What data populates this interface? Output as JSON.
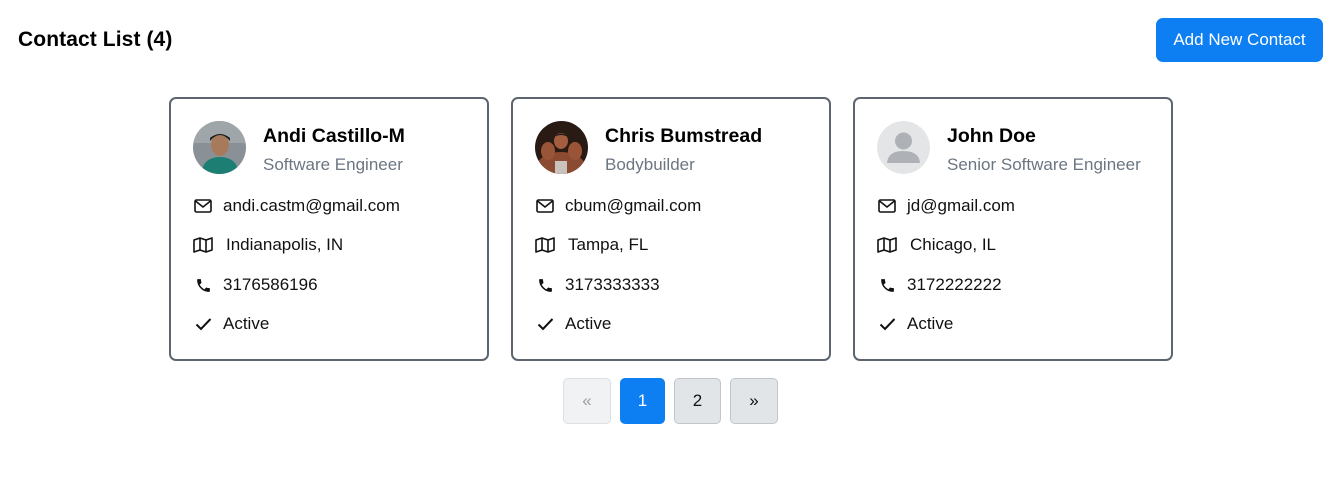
{
  "header": {
    "title": "Contact List (4)",
    "add_button_label": "Add New Contact"
  },
  "accent_color": "#0d7ff2",
  "contacts": [
    {
      "name": "Andi Castillo-M",
      "role": "Software Engineer",
      "email": "andi.castm@gmail.com",
      "city": "Indianapolis, IN",
      "phone": "3176586196",
      "status": "Active",
      "avatar": "photo"
    },
    {
      "name": "Chris Bumstread",
      "role": "Bodybuilder",
      "email": "cbum@gmail.com",
      "city": "Tampa, FL",
      "phone": "3173333333",
      "status": "Active",
      "avatar": "photo"
    },
    {
      "name": "John Doe",
      "role": "Senior Software Engineer",
      "email": "jd@gmail.com",
      "city": "Chicago, IL",
      "phone": "3172222222",
      "status": "Active",
      "avatar": "placeholder"
    }
  ],
  "pagination": {
    "prev_label": "«",
    "pages": [
      "1",
      "2"
    ],
    "current_page": "1",
    "next_label": "»"
  },
  "icons": {
    "email": "envelope-icon",
    "city": "map-icon",
    "phone": "phone-icon",
    "status": "check-icon"
  }
}
